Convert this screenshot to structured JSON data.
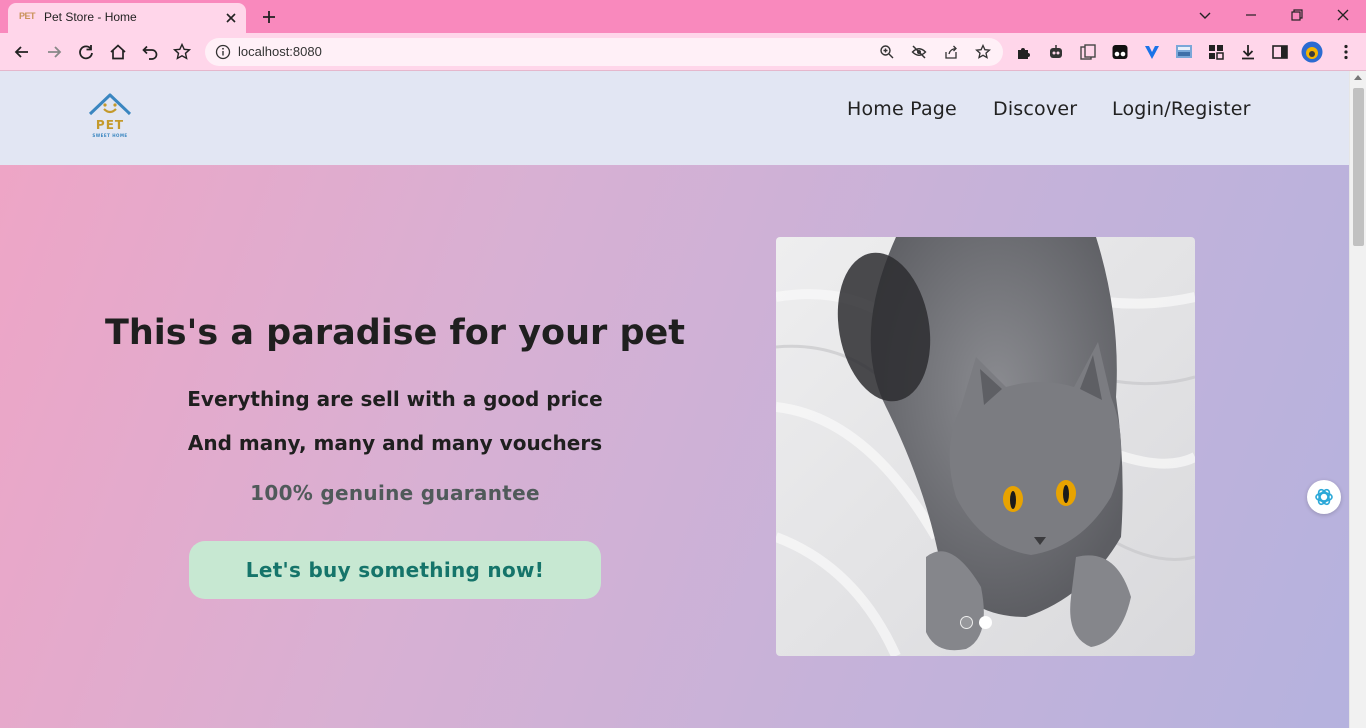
{
  "browser": {
    "tab": {
      "favicon_text": "PET",
      "title": "Pet Store - Home"
    },
    "address": {
      "url": "localhost:8080"
    },
    "colors": {
      "tabstrip": "#f989bd",
      "toolbar": "#ffd6ea"
    },
    "toolbar_icons": [
      "back-icon",
      "forward-icon",
      "reload-icon",
      "home-icon",
      "undo-icon",
      "bookmark-star-icon"
    ],
    "omnibox_icons": [
      "zoom-icon",
      "eye-off-icon",
      "share-icon",
      "star-icon"
    ],
    "extension_icons": [
      "extensions-puzzle-icon",
      "robot-icon",
      "copy-icon",
      "tampermonkey-icon",
      "vpn-icon",
      "screen-icon",
      "grid-icon",
      "download-icon",
      "side-panel-icon",
      "profile-avatar-icon",
      "menu-dots-icon"
    ]
  },
  "site": {
    "logo": {
      "text": "PET",
      "subtitle": "SWEET HOME"
    },
    "nav": [
      "Home Page",
      "Discover",
      "Login/Register"
    ],
    "hero": {
      "title": "This's a paradise for your pet",
      "line1": "Everything are sell with a good price",
      "line2": "And many, many and many vouchers",
      "guarantee": "100% genuine guarantee",
      "cta": "Let's buy something now!"
    },
    "slider": {
      "slide_count": 2,
      "active_index": 1,
      "image": "gray cat lying on white blanket"
    },
    "colors": {
      "header_bg": "#e2e6f3",
      "cta_bg": "#c7e8d2",
      "cta_text": "#15746a"
    }
  }
}
